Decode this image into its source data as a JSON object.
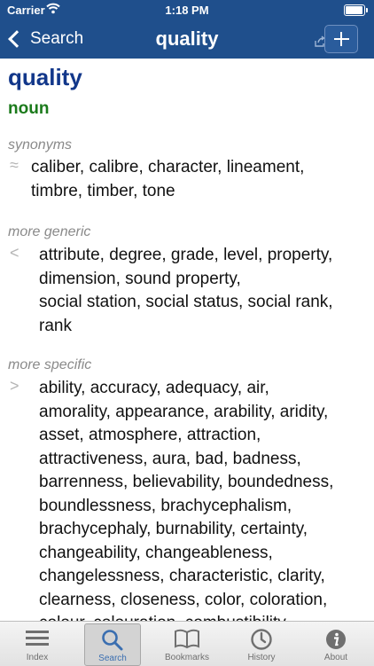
{
  "status_bar": {
    "carrier": "Carrier",
    "time": "1:18 PM"
  },
  "nav": {
    "back_label": "Search",
    "title": "quality"
  },
  "entry": {
    "headword": "quality",
    "part_of_speech": "noun",
    "sections": [
      {
        "label": "synonyms",
        "icon": "≈",
        "lines": [
          "caliber, calibre, character, lineament,",
          "timbre, timber, tone"
        ]
      },
      {
        "label": "more generic",
        "icon": "<",
        "lines": [
          "attribute, degree, grade, level, property,",
          "dimension, sound property,",
          "social station, social status, social rank,",
          "rank"
        ]
      },
      {
        "label": "more specific",
        "icon": ">",
        "lines": [
          "ability, accuracy, adequacy, air,",
          "amorality, appearance, arability, aridity,",
          "asset, atmosphere, attraction,",
          "attractiveness, aura, bad, badness,",
          "barrenness, believability, boundedness,",
          "boundlessness, brachycephalism,",
          "brachycephaly, burnability, certainty,",
          "changeability, changeableness,",
          "changelessness, characteristic, clarity,",
          "clearness, closeness, color, coloration,",
          "colour, colouration, combustibility,"
        ]
      }
    ]
  },
  "tabs": [
    {
      "label": "Index",
      "icon": "index-icon",
      "active": false
    },
    {
      "label": "Search",
      "icon": "search-icon",
      "active": true
    },
    {
      "label": "Bookmarks",
      "icon": "bookmarks-icon",
      "active": false
    },
    {
      "label": "History",
      "icon": "history-icon",
      "active": false
    },
    {
      "label": "About",
      "icon": "about-icon",
      "active": false
    }
  ],
  "colors": {
    "nav_background": "#1f4f8c",
    "headword": "#12378a",
    "part_of_speech": "#1b7a1b",
    "section_label": "#8a8a8a",
    "active_tab": "#3a6eb0"
  }
}
